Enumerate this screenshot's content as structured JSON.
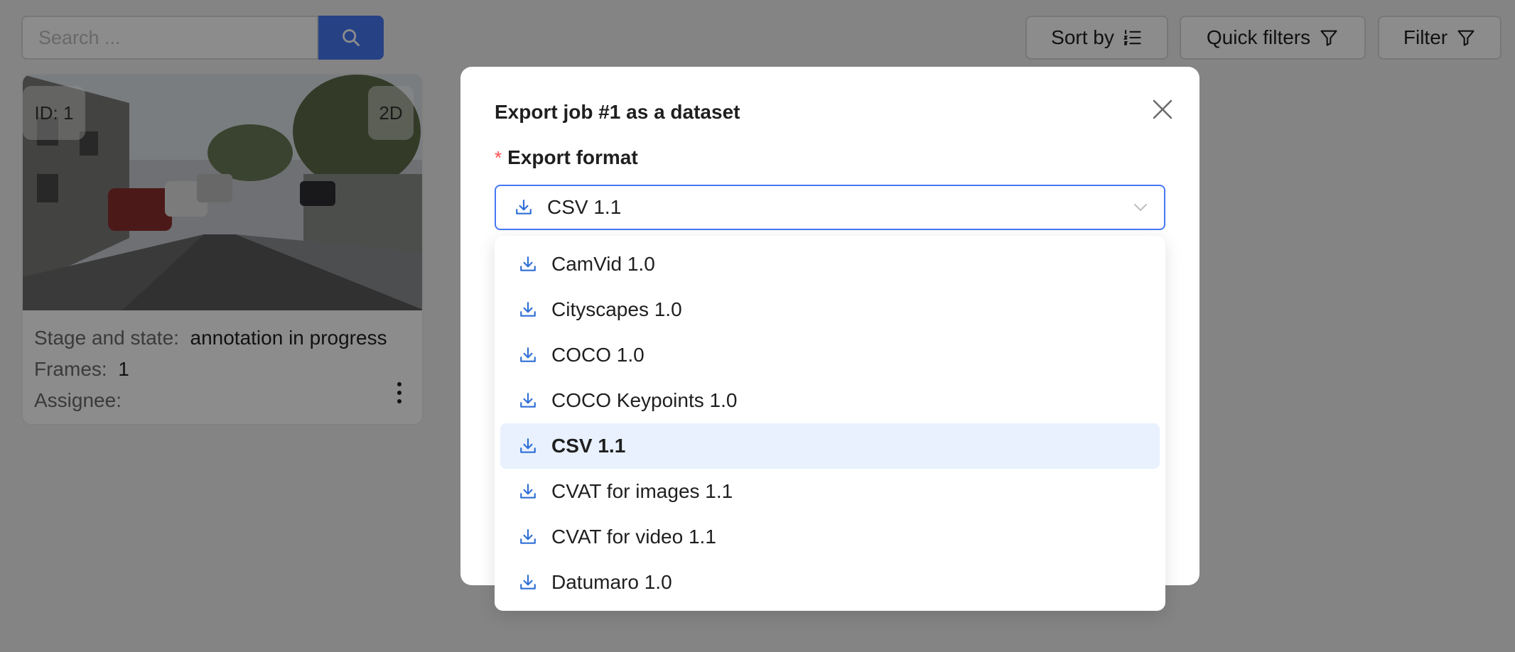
{
  "toolbar": {
    "search_placeholder": "Search ...",
    "sort_label": "Sort by",
    "quick_filters_label": "Quick filters",
    "filter_label": "Filter"
  },
  "job_card": {
    "id_tag": "ID: 1",
    "dim_tag": "2D",
    "stage_label": "Stage and state",
    "stage_value": "annotation in progress",
    "frames_label": "Frames",
    "frames_value": "1",
    "assignee_label": "Assignee"
  },
  "modal": {
    "title": "Export job #1 as a dataset",
    "format_label": "Export format",
    "required_mark": "*",
    "selected_format": "CSV 1.1"
  },
  "dropdown": {
    "options": [
      {
        "label": "CamVid 1.0"
      },
      {
        "label": "Cityscapes 1.0"
      },
      {
        "label": "COCO 1.0"
      },
      {
        "label": "COCO Keypoints 1.0"
      },
      {
        "label": "CSV 1.1",
        "selected": true
      },
      {
        "label": "CVAT for images 1.1"
      },
      {
        "label": "CVAT for video 1.1"
      },
      {
        "label": "Datumaro 1.0"
      }
    ]
  },
  "colors": {
    "accent": "#4578f3",
    "selected_bg": "#e8f1fd",
    "required": "#ff4d4f",
    "icon_blue": "#2f6fd6"
  },
  "icons": [
    "search-icon",
    "sort-list-icon",
    "funnel-icon",
    "more-vertical-icon",
    "close-icon",
    "download-icon",
    "chevron-down-icon"
  ]
}
